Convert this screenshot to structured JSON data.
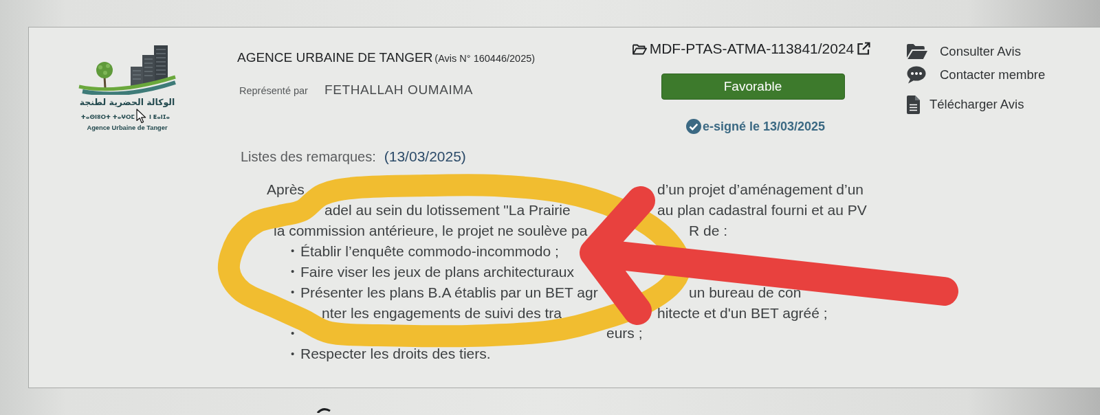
{
  "logo": {
    "arabic": "الوكالة الحضرية لطنجة",
    "tifinagh": [
      "ⵜⴰⵙⵏⵓⵔⵜ ⵜⴰⵖⵔⵎ",
      "ⵏ ⵟⴰⵏⵊⴰ"
    ],
    "french": "Agence Urbaine de Tanger"
  },
  "agency": {
    "name": "AGENCE URBAINE DE TANGER",
    "notice_number": "(Avis N° 160446/2025)",
    "represented_label": "Représenté par",
    "representative": "FETHALLAH OUMAIMA"
  },
  "file": {
    "reference": "MDF-PTAS-ATMA-113841/2024",
    "status": "Favorable",
    "signature": "e-signé le 13/03/2025"
  },
  "actions": [
    {
      "label": "Consulter Avis"
    },
    {
      "label": "Contacter membre"
    },
    {
      "label": "Télécharger Avis"
    }
  ],
  "remarks": {
    "title": "Listes des remarques:",
    "date": "(13/03/2025)",
    "paragraph": [
      [
        "Après",
        "d’un projet d’aménagement d’un"
      ],
      [
        "adel au sein du lotissement \"La Prairie",
        "au plan cadastral fourni et au PV"
      ],
      [
        "la commission antérieure, le projet ne soulève pa",
        "R de :"
      ]
    ],
    "items": [
      {
        "bullet": "•",
        "fragments": [
          "Établir l’enquête commodo-incommodo ;"
        ]
      },
      {
        "bullet": "•",
        "fragments": [
          "Faire viser les jeux de plans architecturaux"
        ]
      },
      {
        "bullet": "•",
        "fragments": [
          "Présenter les plans B.A établis par un BET agr",
          "un bureau de con"
        ]
      },
      {
        "fragments": [
          "nter les engagements de suivi des tra",
          "hitecte et d'un BET agréé ;"
        ]
      },
      {
        "bullet": "•",
        "fragments": [
          "eurs ;"
        ]
      },
      {
        "bullet": "•",
        "fragments": [
          "Respecter les droits des tiers."
        ]
      }
    ]
  }
}
